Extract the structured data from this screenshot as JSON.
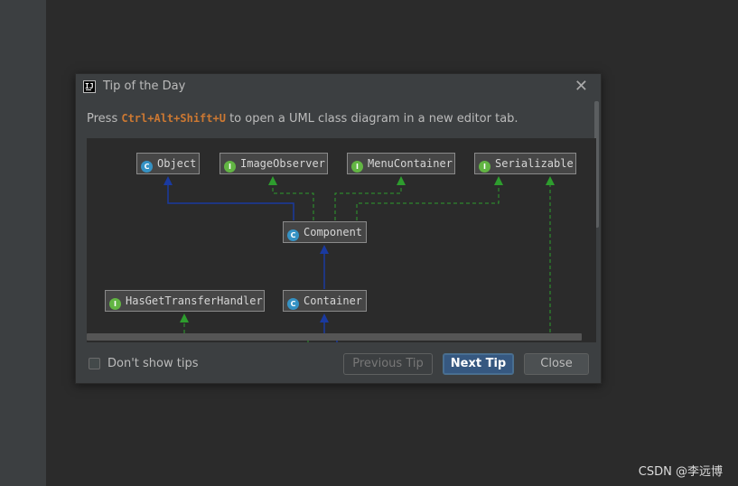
{
  "dialog": {
    "title": "Tip of the Day",
    "close_glyph": "✕",
    "app_icon": "intellij-icon",
    "app_icon_text": "IJ",
    "tip_prefix": "Press ",
    "tip_shortcut": "Ctrl+Alt+Shift+U",
    "tip_suffix": " to open a UML class diagram in a new editor tab."
  },
  "diagram": {
    "nodes": [
      {
        "kind": "C",
        "label": "Object"
      },
      {
        "kind": "I",
        "label": "ImageObserver"
      },
      {
        "kind": "I",
        "label": "MenuContainer"
      },
      {
        "kind": "I",
        "label": "Serializable"
      },
      {
        "kind": "C",
        "label": "Component"
      },
      {
        "kind": "I",
        "label": "HasGetTransferHandler"
      },
      {
        "kind": "C",
        "label": "Container"
      }
    ],
    "colors": {
      "extends": "#1a3aa0",
      "implements": "#2e9d2e",
      "class_badge": "#3592c4",
      "interface_badge": "#62b543"
    }
  },
  "footer": {
    "dont_show_label": "Don't show tips",
    "dont_show_checked": false,
    "prev_label": "Previous Tip",
    "next_label": "Next Tip",
    "close_label": "Close"
  },
  "watermark": "CSDN @李远博"
}
